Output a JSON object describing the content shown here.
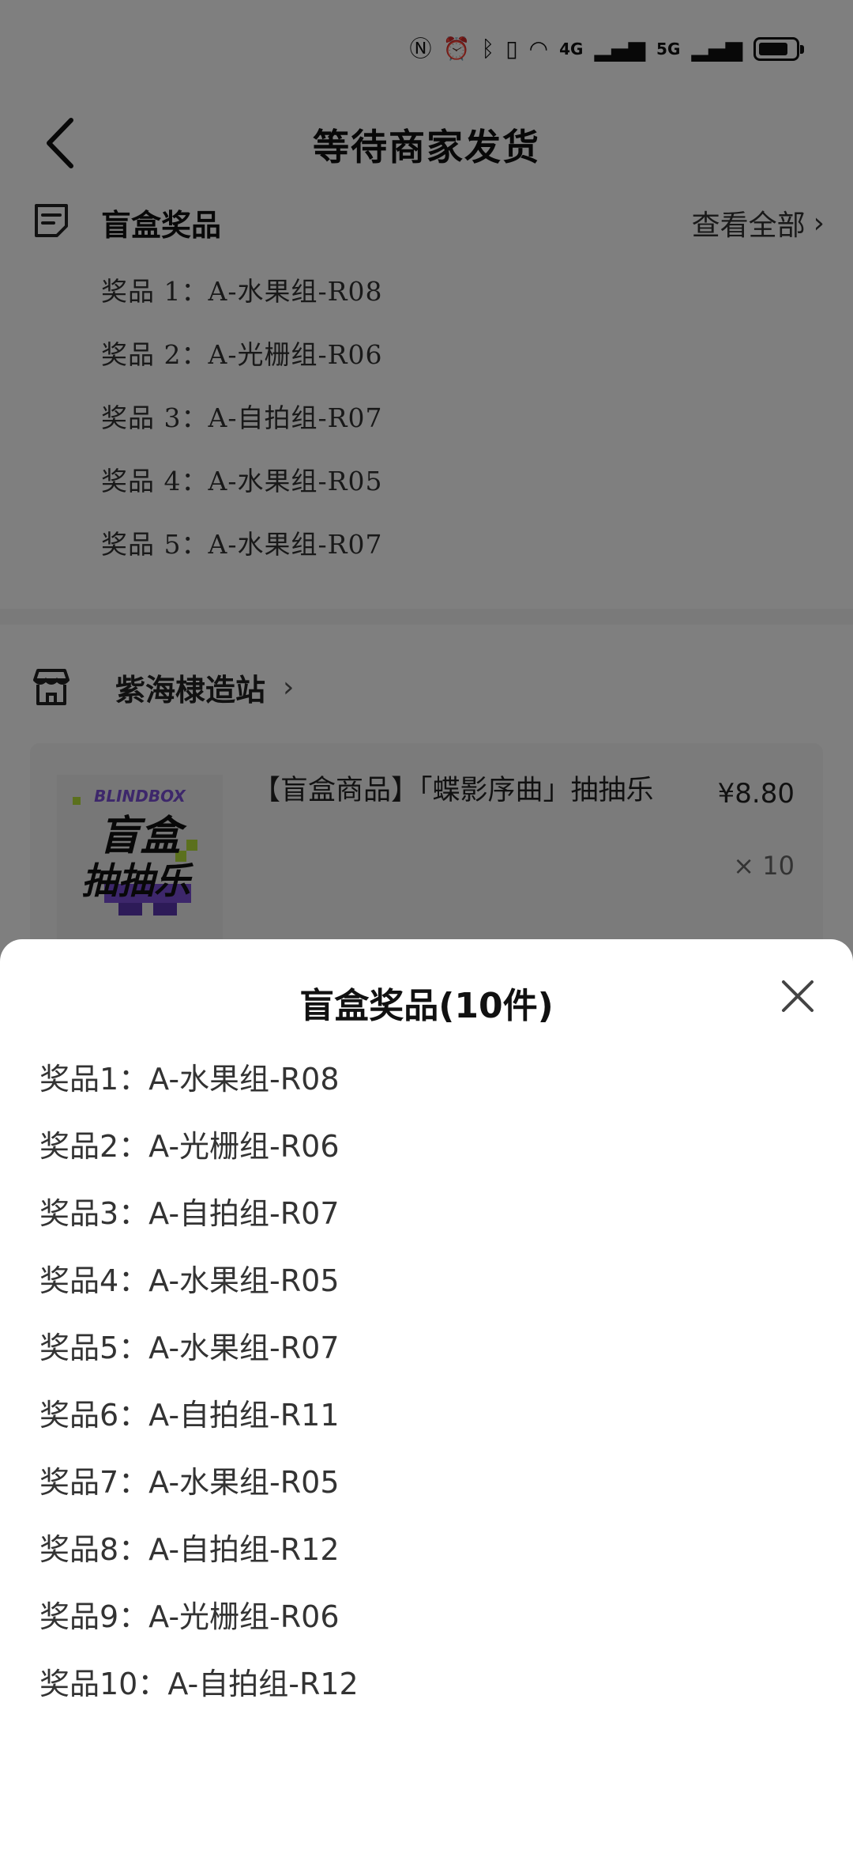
{
  "header": {
    "title": "等待商家发货"
  },
  "prize_card": {
    "title": "盲盒奖品",
    "view_all": "查看全部",
    "items": [
      "奖品 1：A-水果组-R08",
      "奖品 2：A-光栅组-R06",
      "奖品 3：A-自拍组-R07",
      "奖品 4：A-水果组-R05",
      "奖品 5：A-水果组-R07"
    ]
  },
  "shop": {
    "name": "紫海棣造站",
    "product": {
      "title": "【盲盒商品】「蝶影序曲」抽抽乐",
      "price": "¥8.80",
      "quantity": "× 10",
      "thumb_brand": "BLINDBOX",
      "thumb_line1": "盲盒",
      "thumb_line2": "抽抽乐"
    }
  },
  "sheet": {
    "title": "盲盒奖品(10件)",
    "items": [
      "奖品1：A-水果组-R08",
      "奖品2：A-光栅组-R06",
      "奖品3：A-自拍组-R07",
      "奖品4：A-水果组-R05",
      "奖品5：A-水果组-R07",
      "奖品6：A-自拍组-R11",
      "奖品7：A-水果组-R05",
      "奖品8：A-自拍组-R12",
      "奖品9：A-光栅组-R06",
      "奖品10：A-自拍组-R12"
    ]
  },
  "status_bar": {
    "network_a": "4G",
    "network_b": "5G"
  },
  "icons": {
    "nfc": "nfc-icon",
    "alarm": "alarm-icon",
    "bluetooth": "bluetooth-icon",
    "vibrate": "vibrate-icon",
    "wifi": "wifi-icon",
    "battery": "battery-icon",
    "back": "back-arrow-icon",
    "prize": "prize-list-icon",
    "shop": "shop-icon",
    "close": "close-icon"
  },
  "colors": {
    "overlay": "#000000",
    "sheet_bg": "#ffffff",
    "text_primary": "#111111",
    "text_secondary": "#333333"
  }
}
